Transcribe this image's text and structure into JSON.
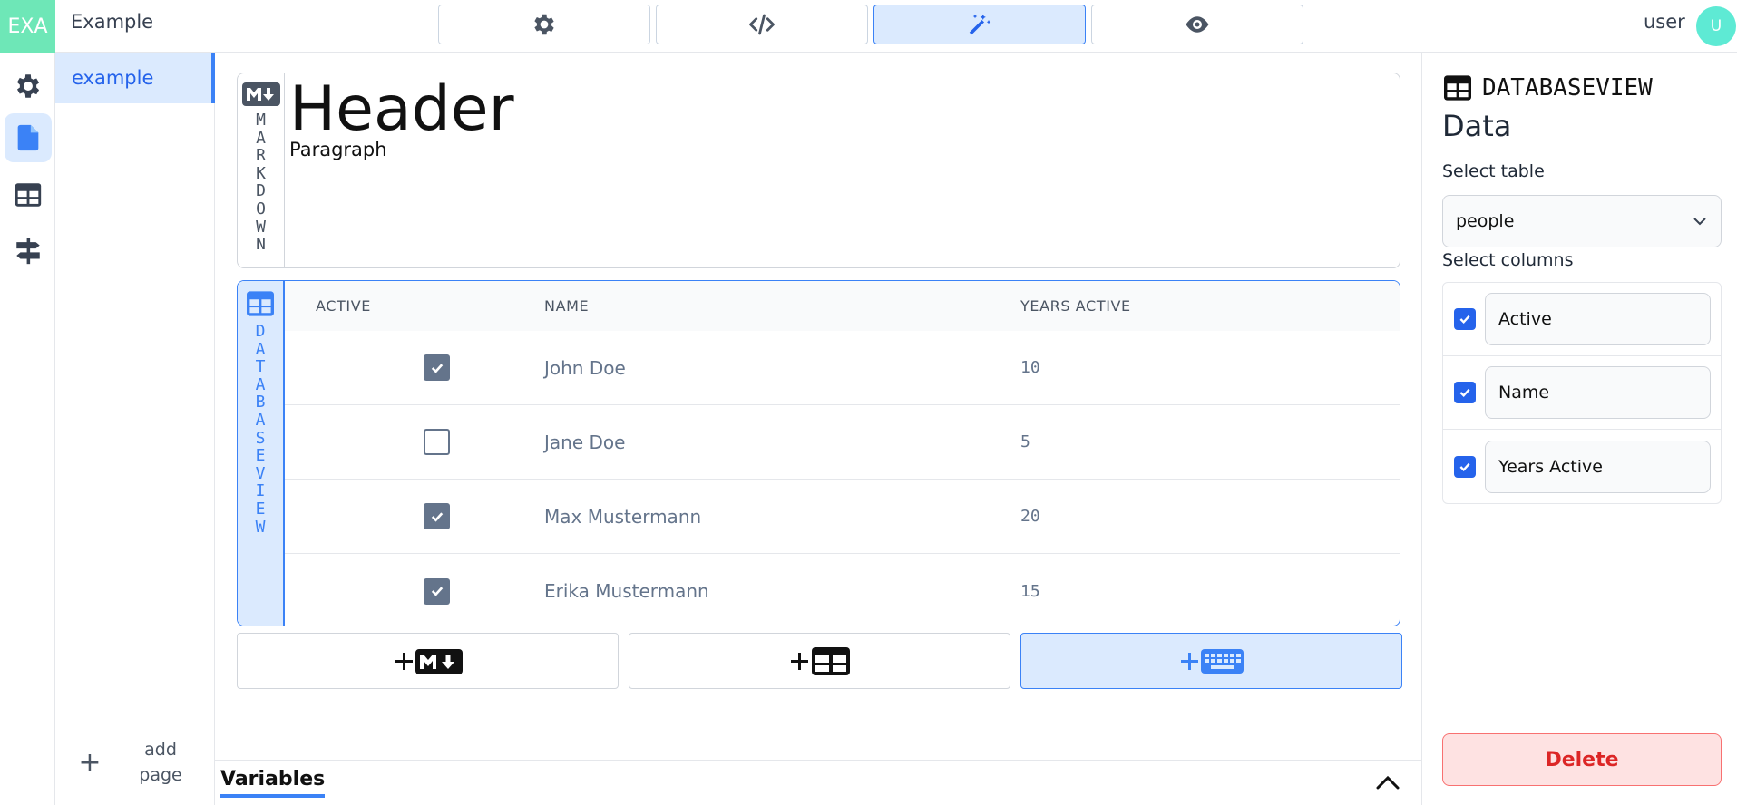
{
  "app": {
    "logo": "EXA",
    "title": "Example",
    "user_name": "user",
    "user_initial": "U"
  },
  "modes": [
    {
      "icon": "gear-icon",
      "active": false
    },
    {
      "icon": "code-icon",
      "active": false
    },
    {
      "icon": "magic-wand-icon",
      "active": true
    },
    {
      "icon": "eye-icon",
      "active": false
    }
  ],
  "rail": [
    {
      "icon": "settings-icon",
      "active": false
    },
    {
      "icon": "page-icon",
      "active": true
    },
    {
      "icon": "table-icon",
      "active": false
    },
    {
      "icon": "signpost-icon",
      "active": false
    }
  ],
  "pages": {
    "items": [
      {
        "label": "example",
        "active": true
      }
    ],
    "add_label": "add page",
    "add_icon": "plus-icon"
  },
  "markdown_block": {
    "tab_label": "MARKDOWN",
    "header": "Header",
    "paragraph": "Paragraph"
  },
  "database_block": {
    "tab_label": "DATABASEVIEW",
    "columns": [
      "ACTIVE",
      "NAME",
      "YEARS ACTIVE"
    ],
    "rows": [
      {
        "active": true,
        "name": "John Doe",
        "years": "10"
      },
      {
        "active": false,
        "name": "Jane Doe",
        "years": "5"
      },
      {
        "active": true,
        "name": "Max Mustermann",
        "years": "20"
      },
      {
        "active": true,
        "name": "Erika Mustermann",
        "years": "15"
      }
    ]
  },
  "adders": [
    {
      "icon": "add-markdown-icon",
      "active": false
    },
    {
      "icon": "add-table-icon",
      "active": false
    },
    {
      "icon": "add-input-icon",
      "active": true
    }
  ],
  "variables": {
    "tab_label": "Variables",
    "toggle_icon": "chevron-up-icon"
  },
  "right_panel": {
    "type_label": "DATABASEVIEW",
    "subtitle": "Data",
    "select_table_label": "Select table",
    "selected_table": "people",
    "select_columns_label": "Select columns",
    "columns": [
      {
        "label": "Active",
        "checked": true
      },
      {
        "label": "Name",
        "checked": true
      },
      {
        "label": "Years Active",
        "checked": true
      }
    ],
    "delete_label": "Delete"
  },
  "colors": {
    "accent": "#3b82f6",
    "accent_light": "#dbeafe",
    "logo_bg": "#6ee7b7",
    "avatar_bg": "#5eead4",
    "danger": "#dc2626",
    "danger_bg": "#fee2e2"
  }
}
